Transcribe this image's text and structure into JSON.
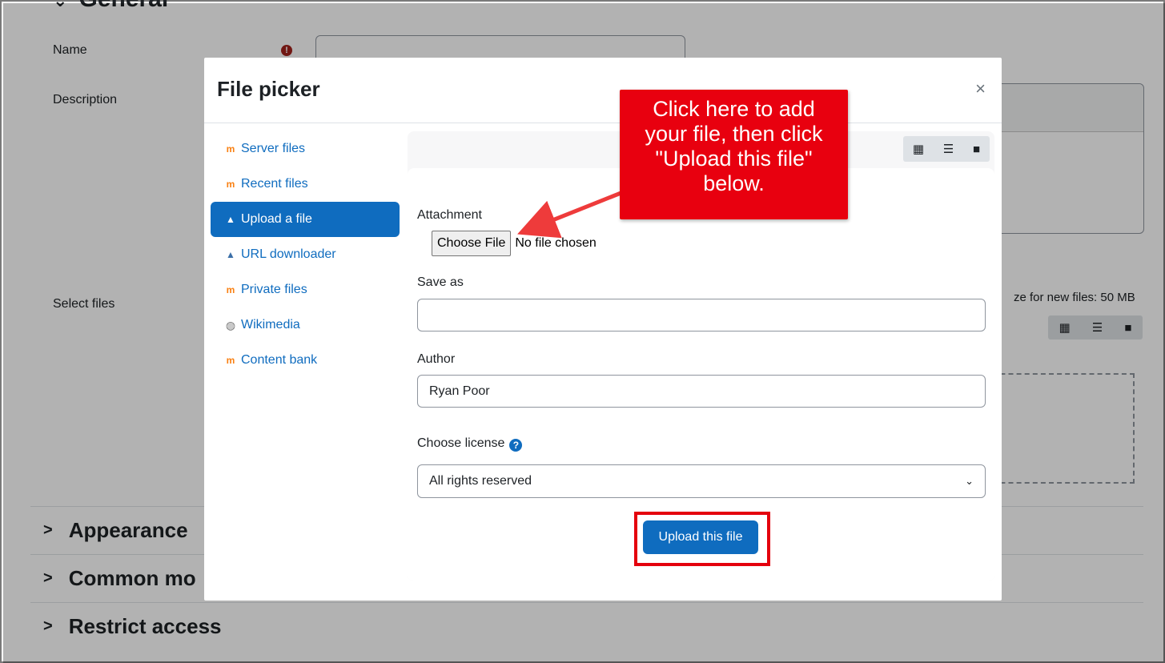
{
  "background": {
    "section_general": "General",
    "name_label": "Name",
    "description_label": "Description",
    "select_files_label": "Select files",
    "max_size_text": "ze for new files: 50 MB",
    "sections": [
      "Appearance",
      "Common mo",
      "Restrict access"
    ]
  },
  "modal": {
    "title": "File picker",
    "close_glyph": "×",
    "repositories": [
      {
        "label": "Server files",
        "icon": "moodle-icon"
      },
      {
        "label": "Recent files",
        "icon": "moodle-icon"
      },
      {
        "label": "Upload a file",
        "icon": "upload-icon",
        "active": true
      },
      {
        "label": "URL downloader",
        "icon": "url-icon"
      },
      {
        "label": "Private files",
        "icon": "moodle-icon"
      },
      {
        "label": "Wikimedia",
        "icon": "globe-icon"
      },
      {
        "label": "Content bank",
        "icon": "moodle-icon"
      }
    ],
    "form": {
      "attachment_label": "Attachment",
      "choose_file_label": "Choose File",
      "no_file_text": "No file chosen",
      "save_as_label": "Save as",
      "save_as_value": "",
      "author_label": "Author",
      "author_value": "Ryan Poor",
      "license_label": "Choose license",
      "license_value": "All rights reserved",
      "upload_button": "Upload this file"
    }
  },
  "annotation": {
    "callout_lines": [
      "Click here to add",
      "your file, then click",
      "\"Upload this file\"",
      "below."
    ],
    "callout_color": "#e8000f"
  }
}
